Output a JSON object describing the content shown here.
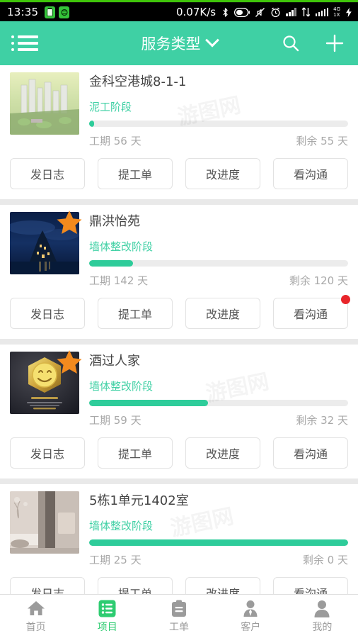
{
  "status_bar": {
    "time": "13:35",
    "network_speed": "0.07K/s",
    "network_type": "4G",
    "network_sub": "1X",
    "icons": [
      "battery-app-icon",
      "antivirus-app-icon",
      "bluetooth-icon",
      "battery-icon",
      "mute-icon",
      "alarm-icon",
      "signal-icon",
      "data-transfer-icon",
      "signal-bars-icon",
      "charging-icon"
    ]
  },
  "header": {
    "title": "服务类型",
    "menu_icon": "list-menu-icon",
    "dropdown_icon": "chevron-down-icon",
    "search_icon": "search-icon",
    "add_icon": "plus-icon",
    "accent_color": "#3fd0a4"
  },
  "labels": {
    "duration_prefix": "工期",
    "remaining_prefix": "剩余",
    "day_unit": "天"
  },
  "actions": [
    {
      "label": "发日志",
      "name": "post-log-button"
    },
    {
      "label": "提工单",
      "name": "submit-work-order-button"
    },
    {
      "label": "改进度",
      "name": "edit-progress-button"
    },
    {
      "label": "看沟通",
      "name": "view-chat-button"
    }
  ],
  "projects": [
    {
      "name": "金科空港城8-1-1",
      "stage": "泥工阶段",
      "progress_percent": 2,
      "duration": "工期 56 天",
      "remaining": "剩余 55 天",
      "starred": false,
      "has_unread": false,
      "thumb": "city-aerial-render-thumb"
    },
    {
      "name": "鼎洪怡苑",
      "stage": "墙体整改阶段",
      "progress_percent": 17,
      "duration": "工期 142 天",
      "remaining": "剩余 120 天",
      "starred": true,
      "has_unread": true,
      "thumb": "night-castle-photo-thumb"
    },
    {
      "name": "酒过人家",
      "stage": "墙体整改阶段",
      "progress_percent": 46,
      "duration": "工期 59 天",
      "remaining": "剩余 32 天",
      "starred": true,
      "has_unread": false,
      "thumb": "smiley-medal-thumb"
    },
    {
      "name": "5栋1单元1402室",
      "stage": "墙体整改阶段",
      "progress_percent": 100,
      "duration": "工期 25 天",
      "remaining": "剩余 0 天",
      "starred": false,
      "has_unread": false,
      "thumb": "interior-room-photo-thumb"
    }
  ],
  "bottom_nav": [
    {
      "label": "首页",
      "icon": "home-icon",
      "active": false
    },
    {
      "label": "项目",
      "icon": "list-icon",
      "active": true
    },
    {
      "label": "工单",
      "icon": "clipboard-icon",
      "active": false
    },
    {
      "label": "客户",
      "icon": "customer-icon",
      "active": false
    },
    {
      "label": "我的",
      "icon": "profile-icon",
      "active": false
    }
  ],
  "watermark": "游图网"
}
